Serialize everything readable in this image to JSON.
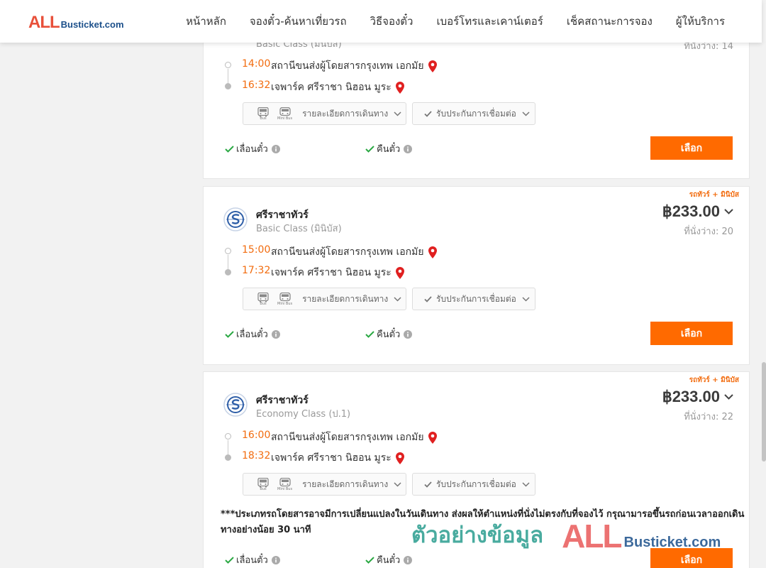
{
  "header": {
    "logo_all": "ALL",
    "logo_rest": "Busticket.com",
    "nav": [
      "หน้าหลัก",
      "จองตั๋ว-ค้นหาเที่ยวรถ",
      "วิธีจองตั๋ว",
      "เบอร์โทรและเคาน์เตอร์",
      "เช็คสถานะการจอง",
      "ผู้ให้บริการ"
    ]
  },
  "colors": {
    "accent": "#ff6a00",
    "time": "#f26c0f",
    "pin": "#e02020",
    "check": "#2aa843"
  },
  "common": {
    "detail_label": "รายละเอียดการเดินทาง",
    "bus_caption": "Bus",
    "minibus_caption": "Mini Bus",
    "insurance_label": "รับประกันการเชื่อมต่อ",
    "reschedule": "เลื่อนตั๋ว",
    "refund": "คืนตั๋ว",
    "select": "เลือก",
    "tag": "รถทัวร์ + มินิบัส"
  },
  "trips": [
    {
      "class": "Basic Class (มินิบัส)",
      "seats": "ที่นั่งว่าง: 14",
      "depart_time": "14:00",
      "depart_station": "สถานีขนส่งผู้โดยสารกรุงเทพ เอกมัย",
      "arrive_time": "16:32",
      "arrive_station": "เจพาร์ค ศรีราชา นิฮอน มูระ"
    },
    {
      "operator": "ศรีราชาทัวร์",
      "class": "Basic Class (มินิบัส)",
      "price": "฿233.00",
      "seats": "ที่นั่งว่าง: 20",
      "depart_time": "15:00",
      "depart_station": "สถานีขนส่งผู้โดยสารกรุงเทพ เอกมัย",
      "arrive_time": "17:32",
      "arrive_station": "เจพาร์ค ศรีราชา นิฮอน มูระ"
    },
    {
      "operator": "ศรีราชาทัวร์",
      "class": "Economy Class (ป.1)",
      "price": "฿233.00",
      "seats": "ที่นั่งว่าง: 22",
      "depart_time": "16:00",
      "depart_station": "สถานีขนส่งผู้โดยสารกรุงเทพ เอกมัย",
      "arrive_time": "18:32",
      "arrive_station": "เจพาร์ค ศรีราชา นิฮอน มูระ",
      "notice": "***ประเภทรถโดยสารอาจมีการเปลี่ยนแปลงในวันเดินทาง ส่งผลให้ตำแหน่งที่นั่งไม่ตรงกับที่จองไว้ กรุณามารอขึ้นรถก่อนเวลาออกเดินทางอย่างน้อย 30 นาที"
    }
  ],
  "watermark": {
    "thai": "ตัวอย่างข้อมูล",
    "all": "ALL",
    "rest": "Busticket.com"
  }
}
